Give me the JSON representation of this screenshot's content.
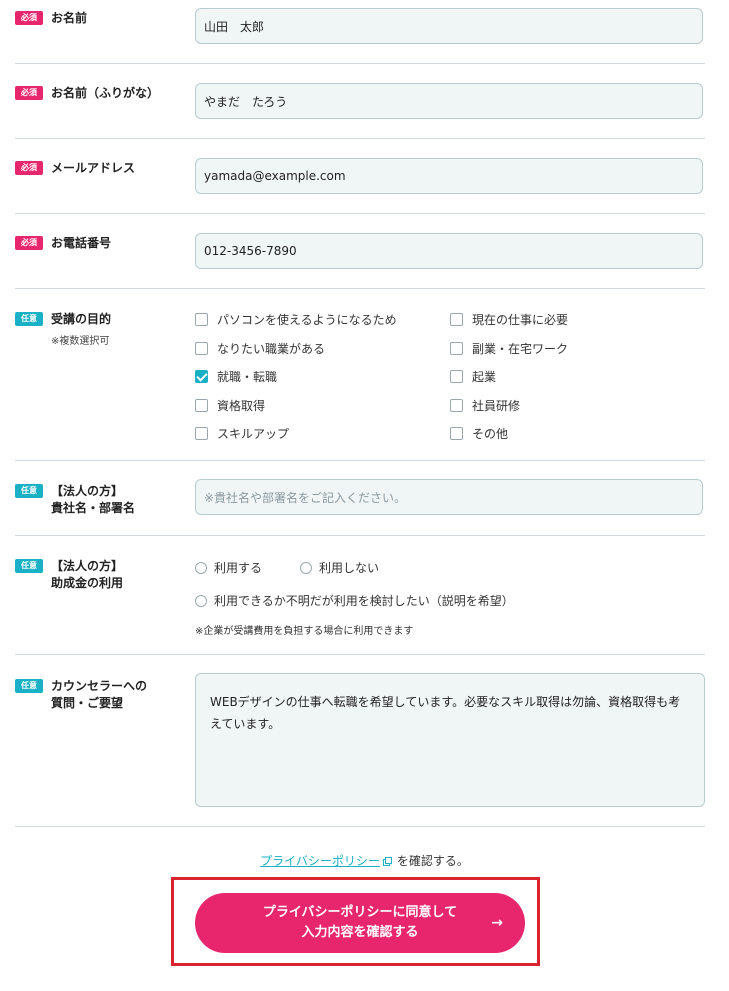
{
  "badges": {
    "required": "必須",
    "optional": "任意"
  },
  "fields": {
    "name": {
      "label": "お名前",
      "value": "山田　太郎"
    },
    "furigana": {
      "label": "お名前（ふりがな）",
      "value": "やまだ　たろう"
    },
    "email": {
      "label": "メールアドレス",
      "value": "yamada@example.com"
    },
    "phone": {
      "label": "お電話番号",
      "value": "012-3456-7890"
    },
    "purpose": {
      "label": "受講の目的",
      "note": "※複数選択可",
      "options": [
        {
          "label": "パソコンを使えるようになるため",
          "checked": false
        },
        {
          "label": "現在の仕事に必要",
          "checked": false
        },
        {
          "label": "なりたい職業がある",
          "checked": false
        },
        {
          "label": "副業・在宅ワーク",
          "checked": false
        },
        {
          "label": "就職・転職",
          "checked": true
        },
        {
          "label": "起業",
          "checked": false
        },
        {
          "label": "資格取得",
          "checked": false
        },
        {
          "label": "社員研修",
          "checked": false
        },
        {
          "label": "スキルアップ",
          "checked": false
        },
        {
          "label": "その他",
          "checked": false
        }
      ]
    },
    "company": {
      "label1": "【法人の方】",
      "label2": "貴社名・部署名",
      "placeholder": "※貴社名や部署名をご記入ください。"
    },
    "subsidy": {
      "label1": "【法人の方】",
      "label2": "助成金の利用",
      "options": [
        "利用する",
        "利用しない",
        "利用できるか不明だが利用を検討したい（説明を希望）"
      ],
      "note": "※企業が受講費用を負担する場合に利用できます"
    },
    "question": {
      "label1": "カウンセラーへの",
      "label2": "質問・ご要望",
      "value": "WEBデザインの仕事へ転職を希望しています。必要なスキル取得は勿論、資格取得も考えています。"
    }
  },
  "privacy": {
    "link": "プライバシーポリシー",
    "suffix": "を確認する。"
  },
  "submit": {
    "line1": "プライバシーポリシーに同意して",
    "line2": "入力内容を確認する",
    "arrow": "→"
  }
}
